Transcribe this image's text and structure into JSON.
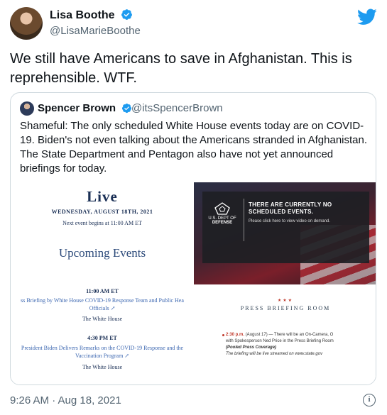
{
  "tweet": {
    "author_name": "Lisa Boothe",
    "author_handle": "@LisaMarieBoothe",
    "text": "We still have Americans to save in Afghanistan. This is reprehensible. WTF.",
    "timestamp": "9:26 AM · Aug 18, 2021"
  },
  "quoted": {
    "author_name": "Spencer Brown",
    "author_handle": "@itsSpencerBrown",
    "text": "Shameful: The only scheduled White House events today are on COVID-19. Biden's not even talking about the Americans stranded in Afghanistan. The State Department and Pentagon also have not yet announced briefings for today."
  },
  "left_image": {
    "live": "Live",
    "date": "WEDNESDAY, AUGUST 18TH, 2021",
    "next": "Next event begins at 11:00 AM ET",
    "heading": "Upcoming Events",
    "events": [
      {
        "time": "11:00 AM ET",
        "title_line1": "ss Briefing by White House COVID-19 Response Team and Public Hea",
        "title_line2": "Officials ↗",
        "host": "The White House"
      },
      {
        "time": "4:30 PM ET",
        "title_line1": "President Biden Delivers Remarks on the COVID-19 Response and the",
        "title_line2": "Vaccination Program ↗",
        "host": "The White House"
      }
    ]
  },
  "right_image": {
    "defense_label_1": "U.S. DEPT OF",
    "defense_label_2": "DEFENSE",
    "no_events": "THERE ARE CURRENTLY NO SCHEDULED EVENTS.",
    "click_view": "Please click here to view video on demand.",
    "stars": "★★★",
    "pbr_title": "PRESS BRIEFING ROOM",
    "pbr_line1_time": "2:30 p.m.",
    "pbr_line1": "(August 17) — There will be an On-Camera, O",
    "pbr_line2": "with Spokesperson Ned Price in the Press Briefing Room",
    "pbr_line3": "(Pooled Press Coverage)",
    "pbr_line4": "The briefing will be live streamed on www.state.gov"
  },
  "colors": {
    "twitter_blue": "#1d9bf0",
    "text": "#0f1419",
    "muted": "#536471"
  },
  "icons": {
    "verified": "verified-badge-icon",
    "bird": "twitter-bird-icon",
    "info": "info-icon"
  }
}
